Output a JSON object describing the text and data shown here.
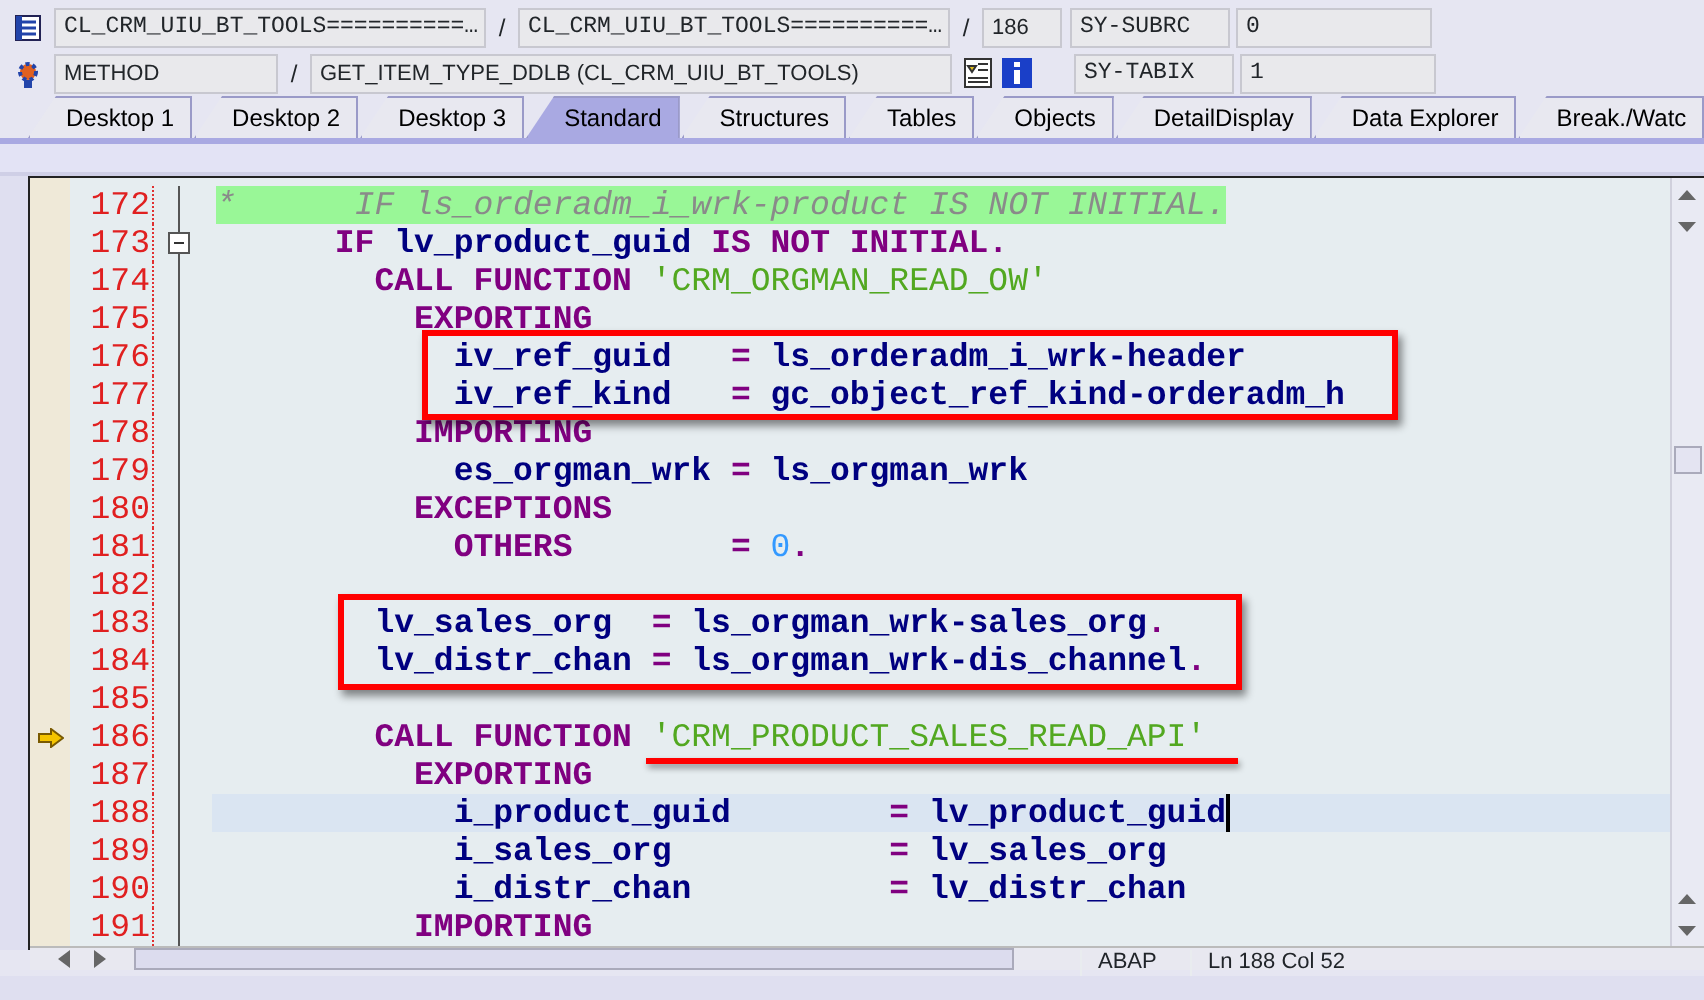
{
  "object_bar": {
    "include": "CL_CRM_UIU_BT_TOOLS==========…",
    "sep_1": "/",
    "class_pool": "CL_CRM_UIU_BT_TOOLS==========…",
    "sep_2": "/",
    "line_no": "186",
    "type": "METHOD",
    "sep_3": "/",
    "method": "GET_ITEM_TYPE_DDLB (CL_CRM_UIU_BT_TOOLS)"
  },
  "variables": [
    {
      "name": "SY-SUBRC",
      "value": "0"
    },
    {
      "name": "SY-TABIX",
      "value": "1"
    }
  ],
  "tabs": [
    {
      "label": "Desktop 1",
      "selected": false
    },
    {
      "label": "Desktop 2",
      "selected": false
    },
    {
      "label": "Desktop 3",
      "selected": false
    },
    {
      "label": "Standard",
      "selected": true
    },
    {
      "label": "Structures",
      "selected": false
    },
    {
      "label": "Tables",
      "selected": false
    },
    {
      "label": "Objects",
      "selected": false
    },
    {
      "label": "DetailDisplay",
      "selected": false
    },
    {
      "label": "Data Explorer",
      "selected": false
    },
    {
      "label": "Break./Watc",
      "selected": false
    }
  ],
  "editor": {
    "lines": [
      {
        "number": "172",
        "current": false,
        "cursor_line": false,
        "tokens": [
          {
            "kind": "comment",
            "text": "*      IF ls_orderadm_i_wrk-product IS NOT INITIAL."
          }
        ]
      },
      {
        "number": "173",
        "current": false,
        "cursor_line": false,
        "expanded": true,
        "tokens": [
          {
            "kind": "keyword",
            "text": "      IF "
          },
          {
            "kind": "ident",
            "text": "lv_product_guid "
          },
          {
            "kind": "keyword",
            "text": "IS NOT INITIAL."
          }
        ]
      },
      {
        "number": "174",
        "current": false,
        "cursor_line": false,
        "tokens": [
          {
            "kind": "keyword",
            "text": "        CALL FUNCTION "
          },
          {
            "kind": "string",
            "text": "'CRM_ORGMAN_READ_OW'"
          }
        ]
      },
      {
        "number": "175",
        "current": false,
        "cursor_line": false,
        "tokens": [
          {
            "kind": "keyword",
            "text": "          EXPORTING"
          }
        ]
      },
      {
        "number": "176",
        "current": false,
        "cursor_line": false,
        "tokens": [
          {
            "kind": "ident",
            "text": "            iv_ref_guid   "
          },
          {
            "kind": "keyword",
            "text": "= "
          },
          {
            "kind": "ident",
            "text": "ls_orderadm_i_wrk-header"
          }
        ]
      },
      {
        "number": "177",
        "current": false,
        "cursor_line": false,
        "tokens": [
          {
            "kind": "ident",
            "text": "            iv_ref_kind   "
          },
          {
            "kind": "keyword",
            "text": "= "
          },
          {
            "kind": "ident",
            "text": "gc_object_ref_kind-orderadm_h"
          }
        ]
      },
      {
        "number": "178",
        "current": false,
        "cursor_line": false,
        "tokens": [
          {
            "kind": "keyword",
            "text": "          IMPORTING"
          }
        ]
      },
      {
        "number": "179",
        "current": false,
        "cursor_line": false,
        "tokens": [
          {
            "kind": "ident",
            "text": "            es_orgman_wrk "
          },
          {
            "kind": "keyword",
            "text": "= "
          },
          {
            "kind": "ident",
            "text": "ls_orgman_wrk"
          }
        ]
      },
      {
        "number": "180",
        "current": false,
        "cursor_line": false,
        "tokens": [
          {
            "kind": "keyword",
            "text": "          EXCEPTIONS"
          }
        ]
      },
      {
        "number": "181",
        "current": false,
        "cursor_line": false,
        "tokens": [
          {
            "kind": "keyword",
            "text": "            OTHERS        = "
          },
          {
            "kind": "number",
            "text": "0"
          },
          {
            "kind": "keyword",
            "text": "."
          }
        ]
      },
      {
        "number": "182",
        "current": false,
        "cursor_line": false
      },
      {
        "number": "183",
        "current": false,
        "cursor_line": false,
        "tokens": [
          {
            "kind": "ident",
            "text": "        lv_sales_org  "
          },
          {
            "kind": "keyword",
            "text": "= "
          },
          {
            "kind": "ident",
            "text": "ls_orgman_wrk-sales_org"
          },
          {
            "kind": "keyword",
            "text": "."
          }
        ]
      },
      {
        "number": "184",
        "current": false,
        "cursor_line": false,
        "tokens": [
          {
            "kind": "ident",
            "text": "        lv_distr_chan "
          },
          {
            "kind": "keyword",
            "text": "= "
          },
          {
            "kind": "ident",
            "text": "ls_orgman_wrk-dis_channel"
          },
          {
            "kind": "keyword",
            "text": "."
          }
        ]
      },
      {
        "number": "185",
        "current": false,
        "cursor_line": false
      },
      {
        "number": "186",
        "current": true,
        "cursor_line": false,
        "tokens": [
          {
            "kind": "keyword",
            "text": "        CALL FUNCTION "
          },
          {
            "kind": "string",
            "text": "'CRM_PRODUCT_SALES_READ_API'"
          }
        ]
      },
      {
        "number": "187",
        "current": false,
        "cursor_line": false,
        "tokens": [
          {
            "kind": "keyword",
            "text": "          EXPORTING"
          }
        ]
      },
      {
        "number": "188",
        "current": false,
        "cursor_line": true,
        "tokens": [
          {
            "kind": "ident",
            "text": "            i_product_guid        "
          },
          {
            "kind": "keyword",
            "text": "= "
          },
          {
            "kind": "ident",
            "text": "lv_product_guid"
          }
        ]
      },
      {
        "number": "189",
        "current": false,
        "cursor_line": false,
        "tokens": [
          {
            "kind": "ident",
            "text": "            i_sales_org           "
          },
          {
            "kind": "keyword",
            "text": "= "
          },
          {
            "kind": "ident",
            "text": "lv_sales_org"
          }
        ]
      },
      {
        "number": "190",
        "current": false,
        "cursor_line": false,
        "tokens": [
          {
            "kind": "ident",
            "text": "            i_distr_chan          "
          },
          {
            "kind": "keyword",
            "text": "= "
          },
          {
            "kind": "ident",
            "text": "lv_distr_chan"
          }
        ]
      },
      {
        "number": "191",
        "current": false,
        "cursor_line": false,
        "tokens": [
          {
            "kind": "keyword",
            "text": "          IMPORTING"
          }
        ]
      }
    ]
  },
  "status_bar": [
    "ABAP",
    "Ln 188 Col 52"
  ]
}
